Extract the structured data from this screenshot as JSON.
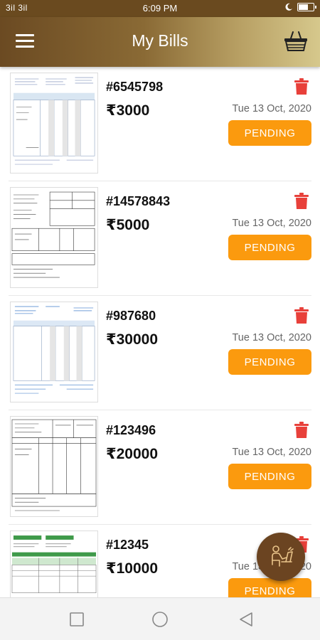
{
  "status_bar": {
    "signal": "3il 3il",
    "time": "6:09 PM"
  },
  "header": {
    "title": "My Bills"
  },
  "bills": [
    {
      "id": "#6545798",
      "amount": "3000",
      "date": "Tue 13 Oct, 2020",
      "status": "PENDING"
    },
    {
      "id": "#14578843",
      "amount": "5000",
      "date": "Tue 13 Oct, 2020",
      "status": "PENDING"
    },
    {
      "id": "#987680",
      "amount": "30000",
      "date": "Tue 13 Oct, 2020",
      "status": "PENDING"
    },
    {
      "id": "#123496",
      "amount": "20000",
      "date": "Tue 13 Oct, 2020",
      "status": "PENDING"
    },
    {
      "id": "#12345",
      "amount": "10000",
      "date": "Tue 13 Oct, 2020",
      "status": "PENDING"
    }
  ],
  "currency_symbol": "₹",
  "icons": {
    "menu": "menu-icon",
    "basket": "basket-icon",
    "delete": "trash-icon",
    "fab": "person-at-desk-icon",
    "nav_recents": "square-icon",
    "nav_home": "circle-icon",
    "nav_back": "triangle-back-icon"
  },
  "colors": {
    "status_pending": "#fb9a0e",
    "delete": "#e8403a",
    "header_start": "#6b4a22",
    "header_end": "#d6c88c",
    "fab": "#6b4421"
  }
}
